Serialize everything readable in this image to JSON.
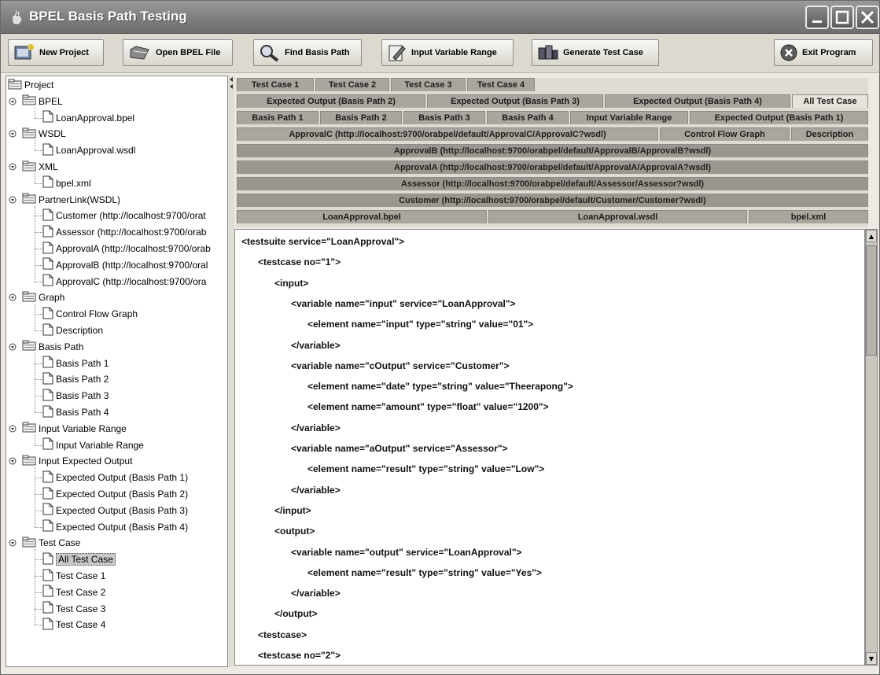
{
  "window": {
    "title": "BPEL Basis Path Testing"
  },
  "toolbar": {
    "new_project": "New Project",
    "open_bpel": "Open BPEL File",
    "find_basis_path": "Find Basis Path",
    "input_variable_range": "Input Variable Range",
    "generate_test_case": "Generate Test Case",
    "exit_program": "Exit Program"
  },
  "tree": {
    "root": "Project",
    "bpel": "BPEL",
    "bpel_file": "LoanApproval.bpel",
    "wsdl": "WSDL",
    "wsdl_file": "LoanApproval.wsdl",
    "xml": "XML",
    "xml_file": "bpel.xml",
    "partnerlink": "PartnerLink(WSDL)",
    "pl_customer": "Customer (http://localhost:9700/orat",
    "pl_assessor": "Assessor (http://localhost:9700/orab",
    "pl_approvala": "ApprovalA (http://localhost:9700/orab",
    "pl_approvalb": "ApprovalB (http://localhost:9700/oral",
    "pl_approvalc": "ApprovalC (http://localhost:9700/ora",
    "graph": "Graph",
    "control_flow_graph": "Control Flow Graph",
    "description": "Description",
    "basis_path": "Basis Path",
    "bp1": "Basis Path 1",
    "bp2": "Basis Path 2",
    "bp3": "Basis Path 3",
    "bp4": "Basis Path 4",
    "ivr_group": "Input Variable Range",
    "ivr_item": "Input Variable Range",
    "ieo_group": "Input Expected Output",
    "eo1": "Expected Output (Basis Path 1)",
    "eo2": "Expected Output (Basis Path 2)",
    "eo3": "Expected Output (Basis Path 3)",
    "eo4": "Expected Output (Basis Path 4)",
    "testcase_group": "Test Case",
    "all_test_case": "All Test Case",
    "tc1": "Test Case 1",
    "tc2": "Test Case 2",
    "tc3": "Test Case 3",
    "tc4": "Test Case 4"
  },
  "tabs": {
    "row1": [
      "Test Case 1",
      "Test Case 2",
      "Test Case 3",
      "Test Case 4"
    ],
    "row2": [
      "Expected Output (Basis Path 2)",
      "Expected Output (Basis Path 3)",
      "Expected Output (Basis Path 4)",
      "All Test Case"
    ],
    "row3": [
      "Basis Path 1",
      "Basis Path 2",
      "Basis Path 3",
      "Basis Path 4",
      "Input Variable Range",
      "Expected Output (Basis Path 1)"
    ],
    "row4": [
      "ApprovalC (http://localhost:9700/orabpel/default/ApprovalC/ApprovalC?wsdl)",
      "Control Flow Graph",
      "Description"
    ],
    "row5": "ApprovalB (http://localhost:9700/orabpel/default/ApprovalB/ApprovalB?wsdl)",
    "row6": "ApprovalA (http://localhost:9700/orabpel/default/ApprovalA/ApprovalA?wsdl)",
    "row7": "Assessor (http://localhost:9700/orabpel/default/Assessor/Assessor?wsdl)",
    "row8": "Customer (http://localhost:9700/orabpel/default/Customer/Customer?wsdl)",
    "row9": [
      "LoanApproval.bpel",
      "LoanApproval.wsdl",
      "bpel.xml"
    ]
  },
  "code": [
    "<testsuite service=\"LoanApproval\">",
    "<testcase no=\"1\">",
    "<input>",
    "<variable name=\"input\" service=\"LoanApproval\">",
    "<element name=\"input\" type=\"string\" value=\"01\">",
    "</variable>",
    "<variable name=\"cOutput\" service=\"Customer\">",
    "<element name=\"date\" type=\"string\" value=\"Theerapong\">",
    "<element name=\"amount\" type=\"float\" value=\"1200\">",
    "</variable>",
    "<variable name=\"aOutput\" service=\"Assessor\">",
    "<element name=\"result\" type=\"string\" value=\"Low\">",
    "</variable>",
    "</input>",
    "<output>",
    "<variable name=\"output\" service=\"LoanApproval\">",
    "<element name=\"result\" type=\"string\" value=\"Yes\">",
    "</variable>",
    "</output>",
    "<testcase>",
    "<testcase no=\"2\">"
  ]
}
